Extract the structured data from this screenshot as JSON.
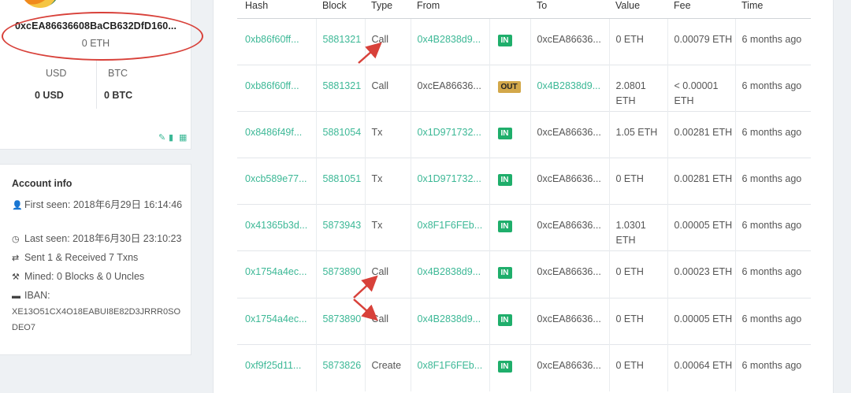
{
  "account": {
    "address": "0xcEA86636608BaCB632DfD160...",
    "eth_balance": "0 ETH",
    "usd_label": "USD",
    "btc_label": "BTC",
    "usd_value": "0 USD",
    "btc_value": "0 BTC"
  },
  "info": {
    "title": "Account info",
    "first_seen": "First seen: 2018年6月29日 16:14:46",
    "last_seen": "Last seen: 2018年6月30日 23:10:23",
    "txns": "Sent 1 & Received 7 Txns",
    "mined": "Mined: 0 Blocks & 0 Uncles",
    "iban_label": "IBAN:",
    "iban_value": "XE13O51CX4O18EABUI8E82D3JRRR0SODEO7"
  },
  "table": {
    "headers": [
      "Hash",
      "Block",
      "Type",
      "From",
      "",
      "To",
      "Value",
      "Fee",
      "Time"
    ],
    "rows": [
      {
        "hash": "0xb86f60ff...",
        "block": "5881321",
        "type": "Call",
        "from": "0x4B2838d9...",
        "dir": "IN",
        "to": "0xcEA86636...",
        "value": "0 ETH",
        "fee": "0.00079 ETH",
        "time": "6 months ago"
      },
      {
        "hash": "0xb86f60ff...",
        "block": "5881321",
        "type": "Call",
        "from": "0xcEA86636...",
        "dir": "OUT",
        "to": "0x4B2838d9...",
        "value": "2.0801 ETH",
        "fee": "< 0.00001 ETH",
        "time": "6 months ago"
      },
      {
        "hash": "0x8486f49f...",
        "block": "5881054",
        "type": "Tx",
        "from": "0x1D971732...",
        "dir": "IN",
        "to": "0xcEA86636...",
        "value": "1.05 ETH",
        "fee": "0.00281 ETH",
        "time": "6 months ago"
      },
      {
        "hash": "0xcb589e77...",
        "block": "5881051",
        "type": "Tx",
        "from": "0x1D971732...",
        "dir": "IN",
        "to": "0xcEA86636...",
        "value": "0 ETH",
        "fee": "0.00281 ETH",
        "time": "6 months ago"
      },
      {
        "hash": "0x41365b3d...",
        "block": "5873943",
        "type": "Tx",
        "from": "0x8F1F6FEb...",
        "dir": "IN",
        "to": "0xcEA86636...",
        "value": "1.0301 ETH",
        "fee": "0.00005 ETH",
        "time": "6 months ago"
      },
      {
        "hash": "0x1754a4ec...",
        "block": "5873890",
        "type": "Call",
        "from": "0x4B2838d9...",
        "dir": "IN",
        "to": "0xcEA86636...",
        "value": "0 ETH",
        "fee": "0.00023 ETH",
        "time": "6 months ago"
      },
      {
        "hash": "0x1754a4ec...",
        "block": "5873890",
        "type": "Call",
        "from": "0x4B2838d9...",
        "dir": "IN",
        "to": "0xcEA86636...",
        "value": "0 ETH",
        "fee": "0.00005 ETH",
        "time": "6 months ago"
      },
      {
        "hash": "0xf9f25d11...",
        "block": "5873826",
        "type": "Create",
        "from": "0x8F1F6FEb...",
        "dir": "IN",
        "to": "0xcEA86636...",
        "value": "0 ETH",
        "fee": "0.00064 ETH",
        "time": "6 months ago"
      }
    ]
  },
  "colors": {
    "link": "#3cb896",
    "in_badge": "#1fae6b",
    "out_badge": "#d3a84a",
    "annotation": "#d8413a"
  },
  "icons": [
    "user-plus-icon",
    "clock-icon",
    "exchange-icon",
    "tools-icon",
    "card-icon",
    "pencil-icon",
    "clipboard-icon",
    "qrcode-icon"
  ]
}
